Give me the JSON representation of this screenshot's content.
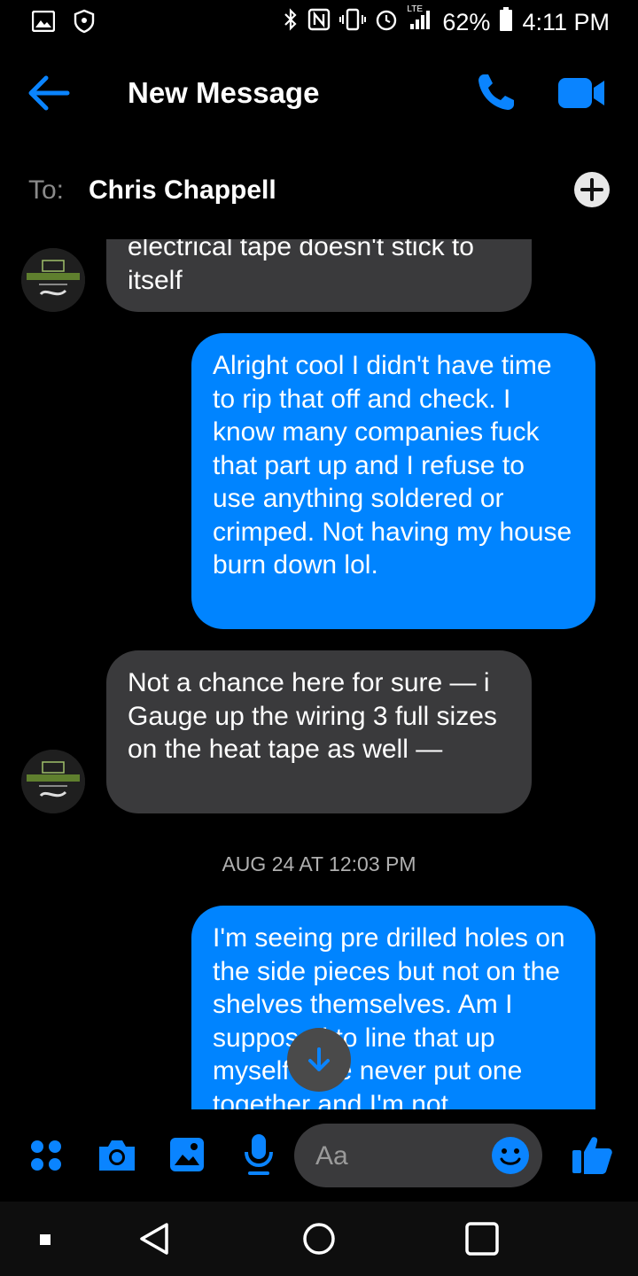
{
  "status_bar": {
    "battery_pct": "62%",
    "time": "4:11 PM",
    "network_label": "LTE"
  },
  "header": {
    "title": "New Message"
  },
  "to_row": {
    "label": "To:",
    "recipient": "Chris Chappell"
  },
  "messages": [
    {
      "direction": "in",
      "text": "electrical tape doesn't stick to itself"
    },
    {
      "direction": "out",
      "text": "Alright cool I didn't have time to rip that off and check. I know many companies fuck that part up and I refuse to use anything soldered or crimped. Not having my house burn down lol."
    },
    {
      "direction": "in",
      "text": "Not a chance here for sure — i Gauge up the wiring 3 full sizes on the heat tape as well —"
    },
    {
      "direction": "out",
      "text": "I'm seeing pre drilled holes on the side pieces but not on the shelves themselves. Am I supposed to line that up myself? I've never put one together and I'm not"
    }
  ],
  "timestamp": "AUG 24 AT 12:03 PM",
  "composer": {
    "placeholder": "Aa"
  },
  "colors": {
    "accent": "#0084ff",
    "incoming_bubble": "#3a3a3c",
    "background": "#000000"
  },
  "icons": [
    "image-icon",
    "shield-icon",
    "bluetooth-icon",
    "nfc-icon",
    "vibrate-icon",
    "alarm-icon",
    "signal-icon",
    "battery-icon",
    "back-arrow-icon",
    "phone-icon",
    "video-camera-icon",
    "plus-icon",
    "apps-icon",
    "camera-icon",
    "gallery-icon",
    "microphone-icon",
    "emoji-icon",
    "thumbs-up-icon",
    "scroll-down-arrow-icon",
    "nav-recents-icon",
    "nav-back-icon",
    "nav-home-icon",
    "nav-overview-icon"
  ]
}
